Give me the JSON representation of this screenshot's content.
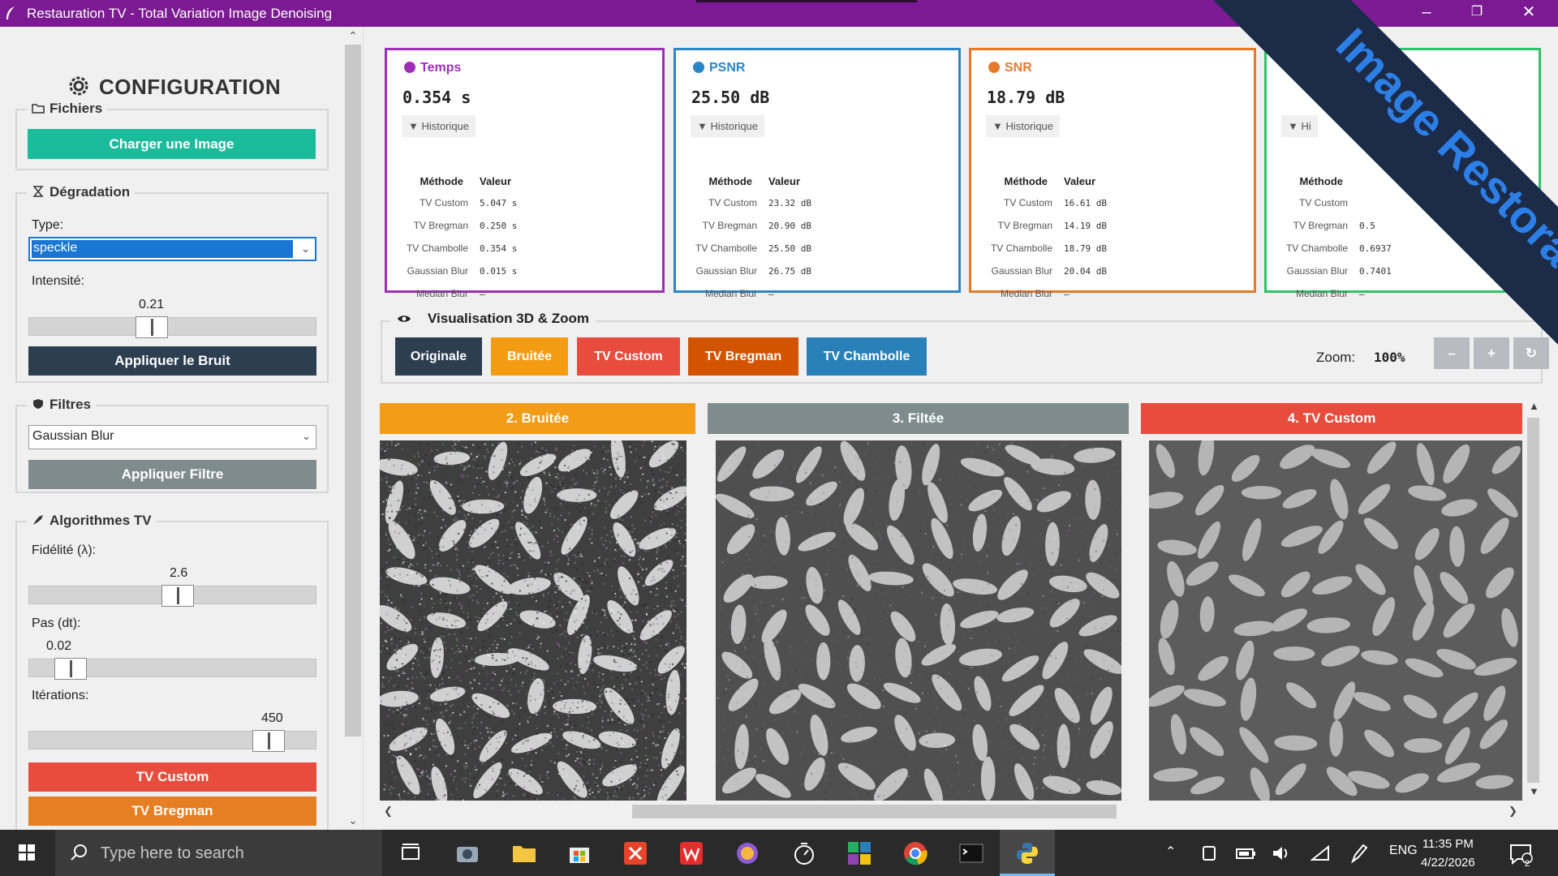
{
  "window": {
    "title": "Restauration TV - Total Variation Image Denoising",
    "controls": {
      "minimize": "–",
      "maximize": "❐",
      "close": "✕"
    }
  },
  "sidebar": {
    "header": "CONFIGURATION",
    "files": {
      "title": "Fichiers",
      "load_button": "Charger une Image"
    },
    "degradation": {
      "title": "Dégradation",
      "type_label": "Type:",
      "type_value": "speckle",
      "intensity_label": "Intensité:",
      "intensity_value": "0.21",
      "intensity_fraction": 0.42,
      "apply_button": "Appliquer le Bruit"
    },
    "filters": {
      "title": "Filtres",
      "filter_value": "Gaussian Blur",
      "apply_button": "Appliquer Filtre"
    },
    "tv": {
      "title": "Algorithmes TV",
      "fidelity_label": "Fidélité (λ):",
      "fidelity_value": "2.6",
      "fidelity_fraction": 0.52,
      "step_label": "Pas (dt):",
      "step_value": "0.02",
      "step_fraction": 0.1,
      "iterations_label": "Itérations:",
      "iterations_value": "450",
      "iterations_fraction": 0.88,
      "btn_custom": "TV Custom",
      "btn_bregman": "TV Bregman"
    }
  },
  "metrics": [
    {
      "title": "Temps",
      "value": "0.354 s",
      "color": "#9b30b6",
      "history": "▼ Historique",
      "col_method": "Méthode",
      "col_value": "Valeur",
      "rows": [
        [
          "TV Custom",
          "5.047 s"
        ],
        [
          "TV Bregman",
          "0.250 s"
        ],
        [
          "TV Chambolle",
          "0.354 s"
        ],
        [
          "Gaussian Blur",
          "0.015 s"
        ],
        [
          "Median Blur",
          "—"
        ]
      ]
    },
    {
      "title": "PSNR",
      "value": "25.50 dB",
      "color": "#2b86c8",
      "history": "▼ Historique",
      "col_method": "Méthode",
      "col_value": "Valeur",
      "rows": [
        [
          "TV Custom",
          "23.32 dB"
        ],
        [
          "TV Bregman",
          "20.90 dB"
        ],
        [
          "TV Chambolle",
          "25.50 dB"
        ],
        [
          "Gaussian Blur",
          "26.75 dB"
        ],
        [
          "Median Blur",
          "—"
        ]
      ]
    },
    {
      "title": "SNR",
      "value": "18.79 dB",
      "color": "#e67a2a",
      "history": "▼ Historique",
      "col_method": "Méthode",
      "col_value": "Valeur",
      "rows": [
        [
          "TV Custom",
          "16.61 dB"
        ],
        [
          "TV Bregman",
          "14.19 dB"
        ],
        [
          "TV Chambolle",
          "18.79 dB"
        ],
        [
          "Gaussian Blur",
          "20.04 dB"
        ],
        [
          "Median Blur",
          "—"
        ]
      ]
    },
    {
      "title": "",
      "value": "",
      "color": "#2ec36a",
      "history": "▼ Hi",
      "col_method": "Méthode",
      "col_value": "",
      "rows": [
        [
          "TV Custom",
          ""
        ],
        [
          "TV Bregman",
          "0.5"
        ],
        [
          "TV Chambolle",
          "0.6937"
        ],
        [
          "Gaussian Blur",
          "0.7401"
        ],
        [
          "Median Blur",
          "—"
        ]
      ]
    }
  ],
  "viz": {
    "title": "Visualisation 3D & Zoom",
    "buttons": [
      "Originale",
      "Bruitée",
      "TV Custom",
      "TV Bregman",
      "TV Chambolle"
    ],
    "zoom_label": "Zoom:",
    "zoom_value": "100%",
    "zoom_out": "–",
    "zoom_in": "+",
    "zoom_reset": "↻"
  },
  "panels": [
    {
      "title": "2. Bruitée",
      "color": "#f29c17"
    },
    {
      "title": "3. Filtée",
      "color": "#7f8c8d"
    },
    {
      "title": "4. TV Custom",
      "color": "#e74c3c"
    }
  ],
  "watermark": "Image Restoration",
  "taskbar": {
    "search_placeholder": "Type here to search",
    "language": "ENG",
    "time": "11:35 PM",
    "date": "4/22/2026",
    "notifications": "2"
  }
}
